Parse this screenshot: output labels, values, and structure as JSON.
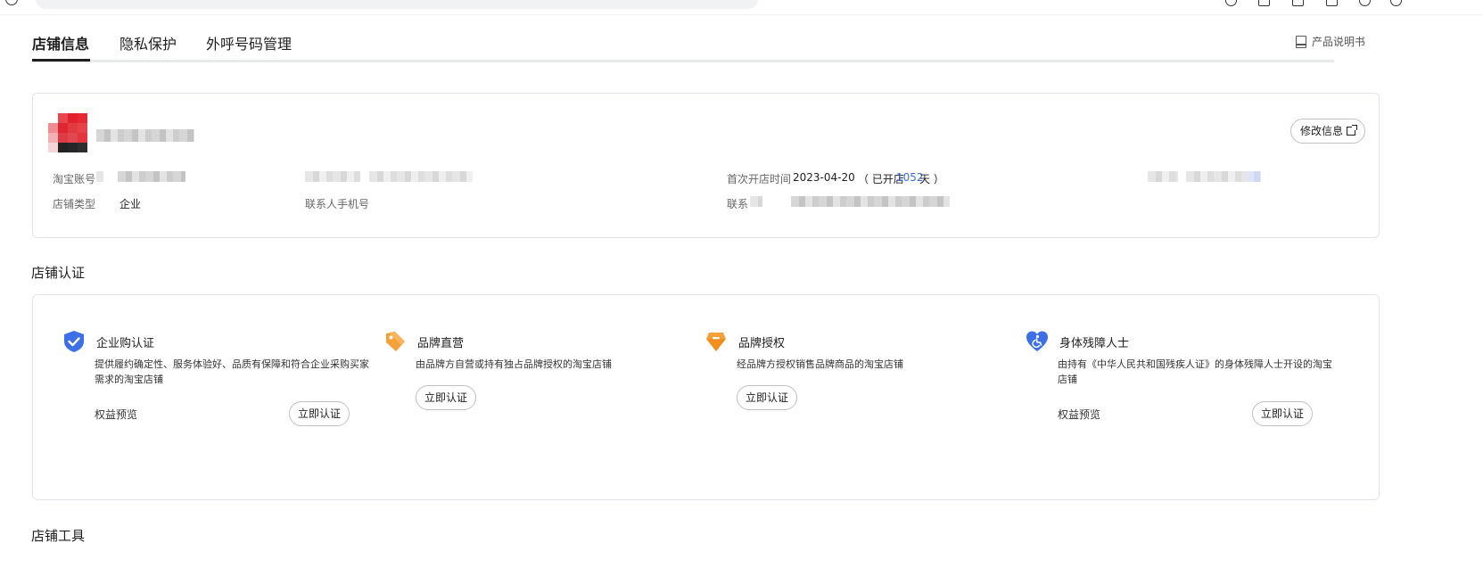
{
  "tabs": [
    {
      "label": "店铺信息",
      "active": true
    },
    {
      "label": "隐私保护",
      "active": false
    },
    {
      "label": "外呼号码管理",
      "active": false
    }
  ],
  "manual_link": "产品说明书",
  "shop_info": {
    "edit_button": "修改信息",
    "taobao_account_label": "淘宝账号",
    "shop_type_label": "店铺类型",
    "shop_type_value": "企业",
    "contact_phone_label": "联系人手机号",
    "first_open_label": "首次开店时间",
    "first_open_date": "2023-04-20",
    "opened_prefix": "（ 已开店",
    "opened_days": "1052",
    "opened_suffix": "天 ）",
    "contact_label_partial": "联系"
  },
  "cert_section_title": "店铺认证",
  "certifications": [
    {
      "title": "企业购认证",
      "icon": "shield-check-icon",
      "color": "#3d6fe6",
      "description": "提供履约确定性、服务体验好、品质有保障和符合企业采购买家需求的淘宝店铺",
      "perk_label": "权益预览",
      "button": "立即认证"
    },
    {
      "title": "品牌直营",
      "icon": "tag-icon",
      "color": "#f5a13a",
      "description": "由品牌方自营或持有独占品牌授权的淘宝店铺",
      "perk_label": "",
      "button": "立即认证"
    },
    {
      "title": "品牌授权",
      "icon": "diamond-badge-icon",
      "color": "#f5a13a",
      "description": "经品牌方授权销售品牌商品的淘宝店铺",
      "perk_label": "",
      "button": "立即认证"
    },
    {
      "title": "身体残障人士",
      "icon": "heart-wheelchair-icon",
      "color": "#3d6fe6",
      "description": "由持有《中华人民共和国残疾人证》的身体残障人士开设的淘宝店铺",
      "perk_label": "权益预览",
      "button": "立即认证"
    }
  ],
  "tools_section_title": "店铺工具"
}
